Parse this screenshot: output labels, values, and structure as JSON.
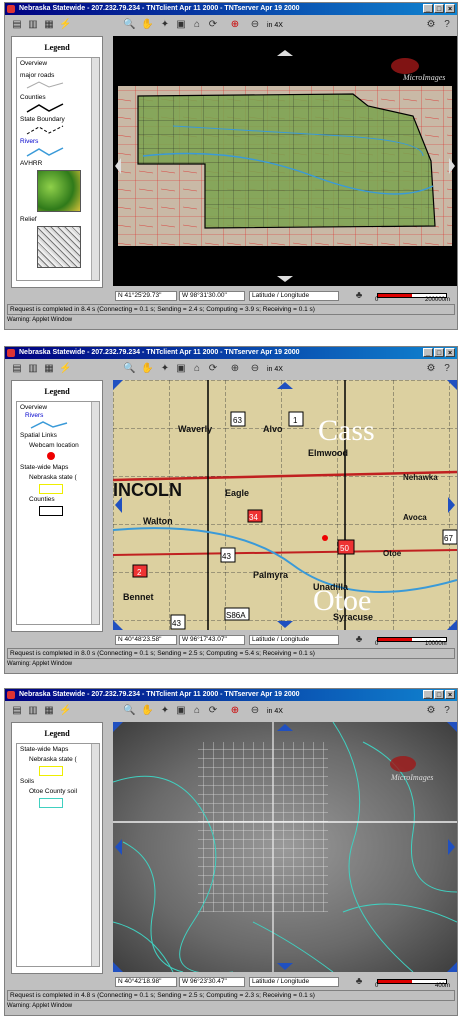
{
  "windows": [
    {
      "title": "Nebraska Statewide - 207.232.79.234 - TNTclient Apr 11 2000 - TNTserver Apr 19 2000",
      "zoom_label": "in 4X",
      "legend_title": "Legend",
      "legend_items": [
        "Overview",
        "major roads",
        "Counties",
        "State Boundary",
        "Rivers",
        "AVHRR",
        "Relief"
      ],
      "lat": "41°25'29.73\"",
      "lon": "98°31'30.00\"",
      "projection": "Latitude / Longitude",
      "scale": "200000m",
      "scale_zero": "0",
      "status": "Request is completed in 8.4 s (Connecting = 0.1 s; Sending = 2.4 s; Computing = 3.9 s; Receiving = 0.1 s)",
      "warning": "Warning: Applet Window",
      "watermark": "MicroImages"
    },
    {
      "title": "Nebraska Statewide - 207.232.79.234 - TNTclient Apr 11 2000 - TNTserver Apr 19 2000",
      "zoom_label": "in 4X",
      "legend_title": "Legend",
      "legend_items": [
        "Overview",
        "Rivers",
        "Spatial Links",
        "Webcam location",
        "State-wide Maps",
        "Nebraska state (",
        "Counties"
      ],
      "lat": "40°48'23.58\"",
      "lon": "96°17'43.07\"",
      "projection": "Latitude / Longitude",
      "scale": "10000m",
      "scale_zero": "0",
      "status": "Request is completed in 8.0 s (Connecting = 0.1 s; Sending = 2.5 s; Computing = 5.4 s; Receiving = 0.1 s)",
      "warning": "Warning: Applet Window",
      "map_labels": [
        "Cass",
        "Otoe",
        "INCOLN",
        "Waverly",
        "Alvo",
        "Elmwood",
        "Eagle",
        "Walton",
        "Palmyra",
        "Unadilla",
        "Bennet",
        "Syracuse",
        "Nehawka",
        "Otoe",
        "Avoca",
        "63",
        "1",
        "43",
        "50",
        "67",
        "2",
        "34",
        "43",
        "S86A"
      ]
    },
    {
      "title": "Nebraska Statewide - 207.232.79.234 - TNTclient Apr 11 2000 - TNTserver Apr 19 2000",
      "zoom_label": "in 4X",
      "legend_title": "Legend",
      "legend_items": [
        "State-wide Maps",
        "Nebraska state (",
        "Soils",
        "Otoe County soil"
      ],
      "lat": "40°42'18.98\"",
      "lon": "96°23'30.47\"",
      "projection": "Latitude / Longitude",
      "scale": "400m",
      "scale_zero": "0",
      "status": "Request is completed in 4.8 s (Connecting = 0.1 s; Sending = 2.5 s; Computing = 2.3 s; Receiving = 0.1 s)",
      "warning": "Warning: Applet Window",
      "watermark": "MicroImages"
    }
  ],
  "icons": [
    "map-window-icon",
    "legend-icon",
    "layers-icon",
    "tool-icon",
    "zoom-in-icon",
    "pan-icon",
    "measure-icon",
    "home-icon",
    "print-icon",
    "zoom-box-icon",
    "zoom-out-icon",
    "help-icon"
  ],
  "colors": {
    "title_bar": "#000080",
    "roads": "#cc2020",
    "rivers": "#3a9ad8",
    "ag_green": "#5a8a3a",
    "soil_cyan": "#40d0c0",
    "parcel_yellow": "#ffff40"
  }
}
